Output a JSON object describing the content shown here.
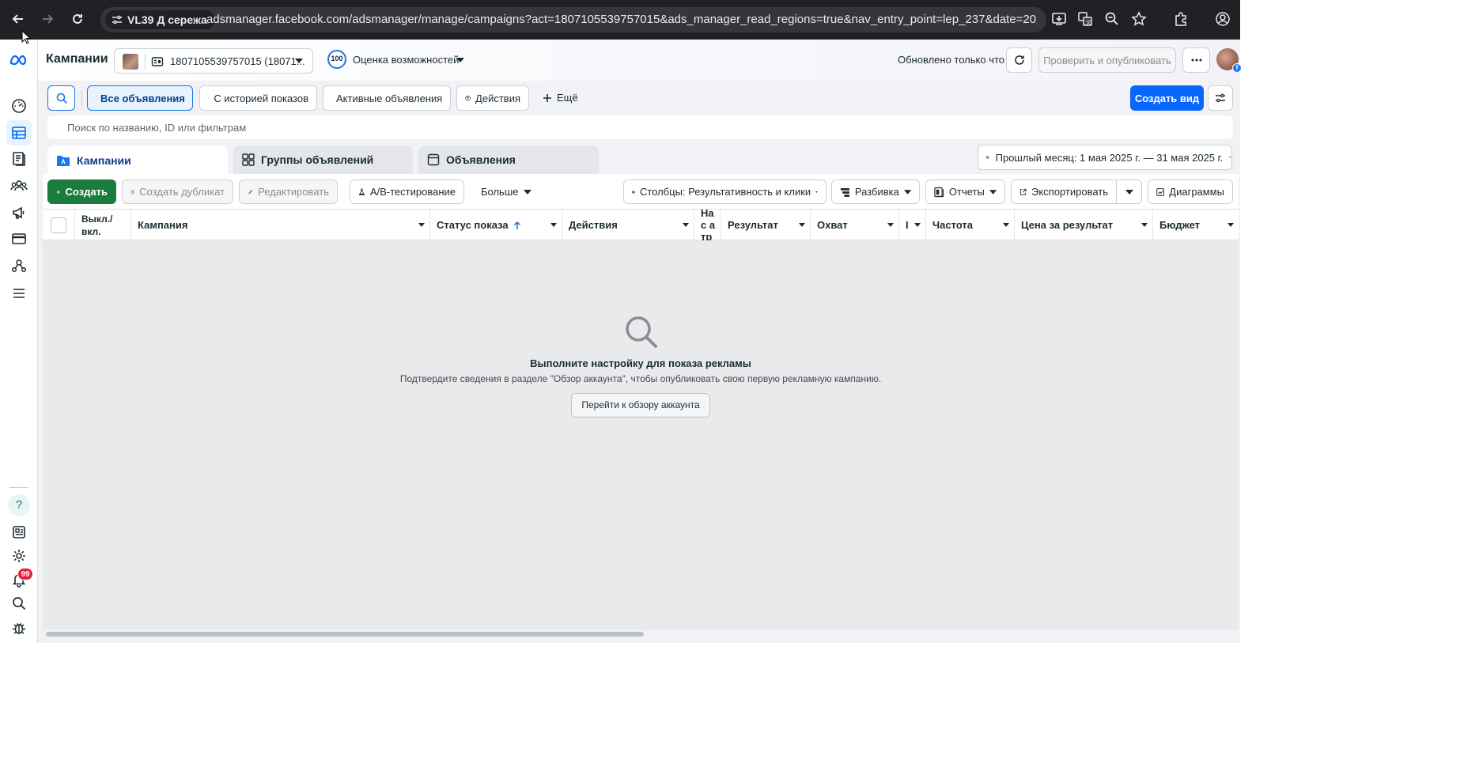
{
  "browser": {
    "profile_chip": "VL39 Д сережа",
    "url": "adsmanager.facebook.com/adsmanager/manage/campaigns?act=1807105539757015&ads_manager_read_regions=true&nav_entry_point=lep_237&date=2025-..."
  },
  "header": {
    "title": "Кампании",
    "account_label": "1807105539757015 (18071...",
    "score_value": "100",
    "score_label": "Оценка возможностей",
    "updated_text": "Обновлено только что",
    "publish_label": "Проверить и опубликовать"
  },
  "rail": {
    "notifications_badge": "99"
  },
  "filters": {
    "all_ads": "Все объявления",
    "with_history": "С историей показов",
    "active_ads": "Активные объявления",
    "actions": "Действия",
    "more": "Ещё",
    "create_view": "Создать вид",
    "search_placeholder": "Поиск по названию, ID или фильтрам"
  },
  "tabs": [
    {
      "label": "Кампании"
    },
    {
      "label": "Группы объявлений"
    },
    {
      "label": "Объявления"
    }
  ],
  "date_range": "Прошлый месяц: 1 мая 2025 г. — 31 мая 2025 г.",
  "toolbar": {
    "create": "Создать",
    "duplicate": "Создать дубликат",
    "edit": "Редактировать",
    "ab_test": "A/B-тестирование",
    "more": "Больше",
    "columns": "Столбцы: Результативность и клики",
    "breakdown": "Разбивка",
    "reports": "Отчеты",
    "export": "Экспортировать",
    "charts": "Диаграммы"
  },
  "table": {
    "columns": [
      "Выкл./ вкл.",
      "Кампания",
      "Статус показа",
      "Действия",
      "Нас атр",
      "Результат",
      "Охват",
      "I",
      "Частота",
      "Цена за результат",
      "Бюджет"
    ]
  },
  "empty_state": {
    "title": "Выполните настройку для показа рекламы",
    "subtitle": "Подтвердите сведения в разделе \"Обзор аккаунта\", чтобы опубликовать свою первую рекламную кампанию.",
    "button": "Перейти к обзору аккаунта"
  },
  "colors": {
    "primary_blue": "#0866ff",
    "create_green": "#1b7c3d",
    "badge_red": "#e41e3f"
  }
}
